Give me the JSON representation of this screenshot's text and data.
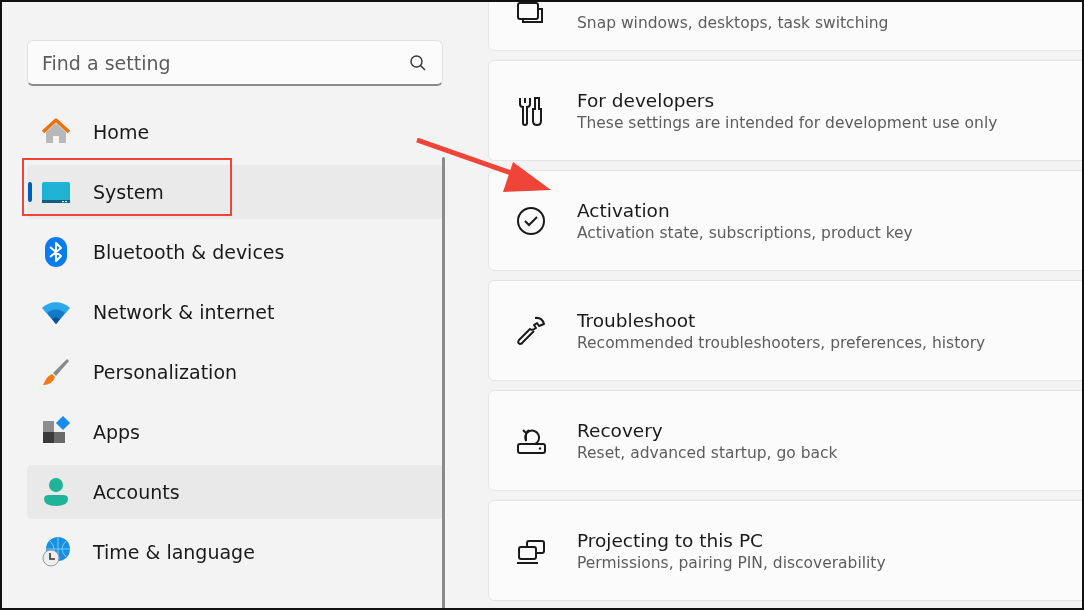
{
  "search": {
    "placeholder": "Find a setting"
  },
  "sidebar": {
    "items": [
      {
        "label": "Home",
        "kind": "home",
        "selected": false,
        "hovered": false
      },
      {
        "label": "System",
        "kind": "system",
        "selected": true,
        "hovered": false
      },
      {
        "label": "Bluetooth & devices",
        "kind": "bluetooth",
        "selected": false,
        "hovered": false
      },
      {
        "label": "Network & internet",
        "kind": "network",
        "selected": false,
        "hovered": false
      },
      {
        "label": "Personalization",
        "kind": "brush",
        "selected": false,
        "hovered": false
      },
      {
        "label": "Apps",
        "kind": "apps",
        "selected": false,
        "hovered": false
      },
      {
        "label": "Accounts",
        "kind": "accounts",
        "selected": false,
        "hovered": true
      },
      {
        "label": "Time & language",
        "kind": "time",
        "selected": false,
        "hovered": false
      }
    ]
  },
  "cards": [
    {
      "kind": "windows",
      "description": "Snap windows, desktops, task switching"
    },
    {
      "kind": "tools",
      "title": "For developers",
      "description": "These settings are intended for development use only"
    },
    {
      "kind": "check",
      "title": "Activation",
      "description": "Activation state, subscriptions, product key"
    },
    {
      "kind": "wrench",
      "title": "Troubleshoot",
      "description": "Recommended troubleshooters, preferences, history"
    },
    {
      "kind": "recovery",
      "title": "Recovery",
      "description": "Reset, advanced startup, go back"
    },
    {
      "kind": "project",
      "title": "Projecting to this PC",
      "description": "Permissions, pairing PIN, discoverability"
    }
  ]
}
